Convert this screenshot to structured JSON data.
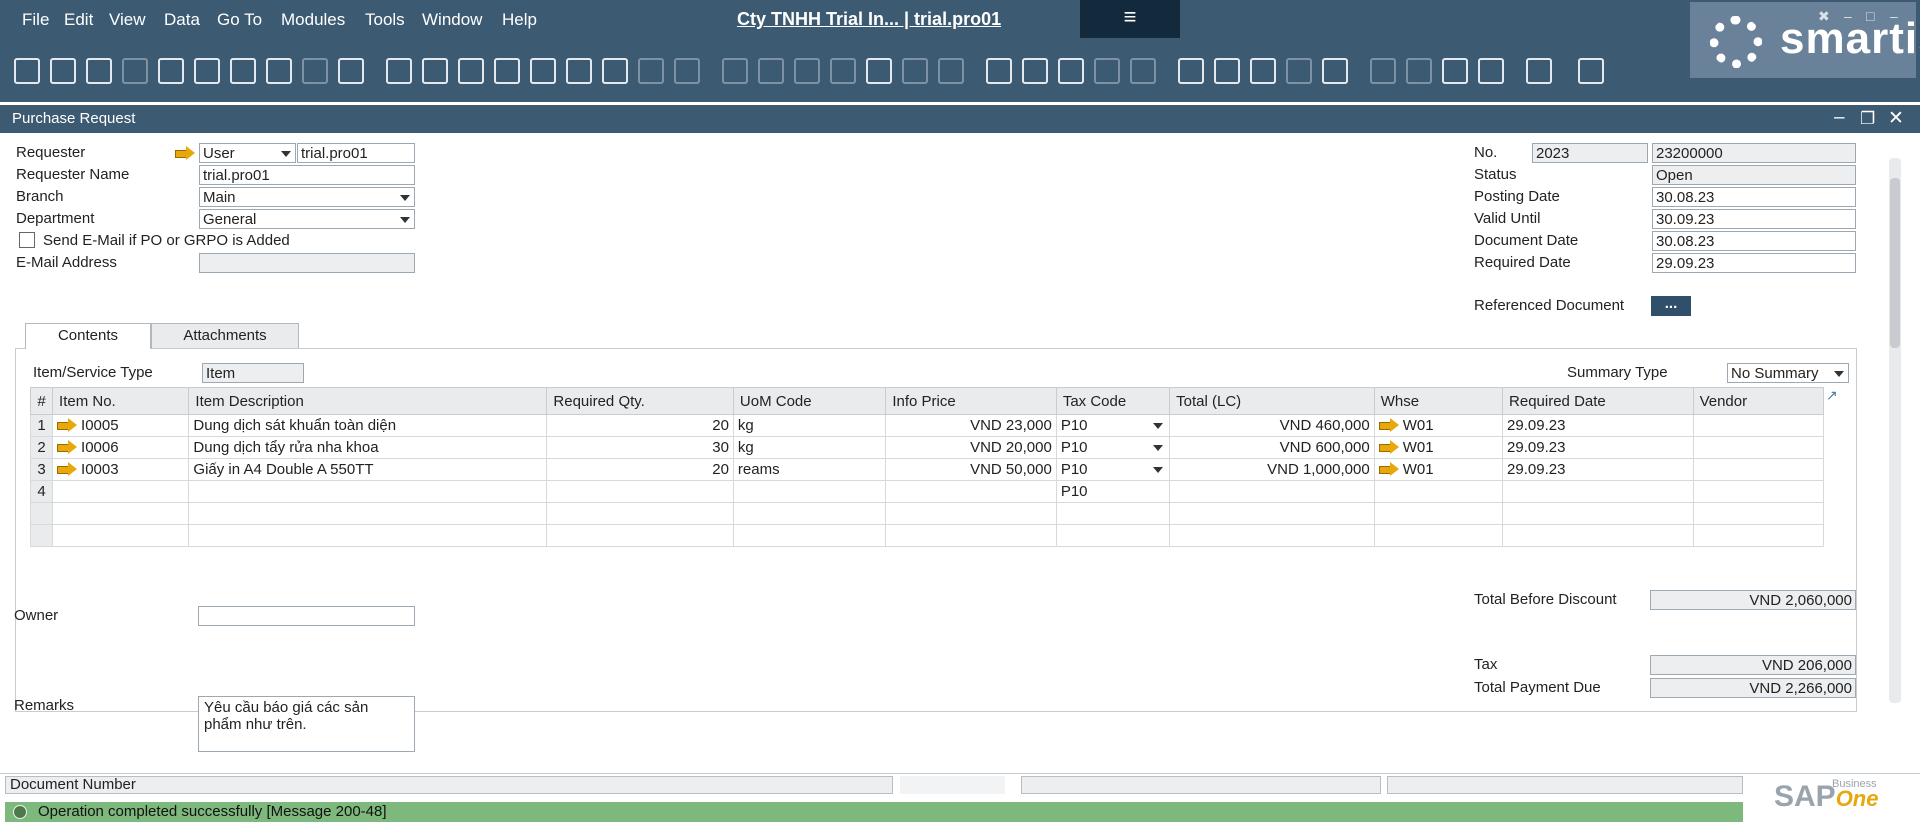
{
  "menu": {
    "items": [
      "File",
      "Edit",
      "View",
      "Data",
      "Go To",
      "Modules",
      "Tools",
      "Window",
      "Help"
    ],
    "title": "Cty TNHH Trial In... | trial.pro01",
    "hamburger": "≡"
  },
  "logo": {
    "text": "smartis"
  },
  "window": {
    "title": "Purchase Request"
  },
  "header_left": {
    "requester_label": "Requester",
    "requester_type": "User",
    "requester_value": "trial.pro01",
    "requester_name_label": "Requester Name",
    "requester_name_value": "trial.pro01",
    "branch_label": "Branch",
    "branch_value": "Main",
    "department_label": "Department",
    "department_value": "General",
    "send_email_label": "Send E-Mail if PO or GRPO is Added",
    "email_label": "E-Mail Address",
    "email_value": ""
  },
  "header_right": {
    "no_label": "No.",
    "no_series": "2023",
    "no_value": "23200000",
    "status_label": "Status",
    "status_value": "Open",
    "posting_label": "Posting Date",
    "posting_value": "30.08.23",
    "valid_label": "Valid Until",
    "valid_value": "30.09.23",
    "docdate_label": "Document Date",
    "docdate_value": "30.08.23",
    "reqdate_label": "Required Date",
    "reqdate_value": "29.09.23",
    "refdoc_label": "Referenced Document",
    "refdoc_button": "..."
  },
  "tabs": [
    "Contents",
    "Attachments"
  ],
  "contents": {
    "type_label": "Item/Service Type",
    "type_value": "Item",
    "summary_label": "Summary Type",
    "summary_value": "No Summary",
    "columns": [
      "#",
      "Item No.",
      "Item Description",
      "Required Qty.",
      "UoM Code",
      "Info Price",
      "Tax Code",
      "Total (LC)",
      "Whse",
      "Required Date",
      "Vendor"
    ],
    "rows": [
      {
        "n": "1",
        "item": "I0005",
        "desc": "Dung dịch sát khuẩn toàn diện",
        "qty": "20",
        "uom": "kg",
        "price": "VND 23,000",
        "tax": "P10",
        "total": "VND 460,000",
        "whse": "W01",
        "date": "29.09.23",
        "vendor": ""
      },
      {
        "n": "2",
        "item": "I0006",
        "desc": "Dung dịch tẩy rửa nha khoa",
        "qty": "30",
        "uom": "kg",
        "price": "VND 20,000",
        "tax": "P10",
        "total": "VND 600,000",
        "whse": "W01",
        "date": "29.09.23",
        "vendor": ""
      },
      {
        "n": "3",
        "item": "I0003",
        "desc": "Giấy in A4 Double A 550TT",
        "qty": "20",
        "uom": "reams",
        "price": "VND 50,000",
        "tax": "P10",
        "total": "VND 1,000,000",
        "whse": "W01",
        "date": "29.09.23",
        "vendor": ""
      },
      {
        "n": "4",
        "item": "",
        "desc": "",
        "qty": "",
        "uom": "",
        "price": "",
        "tax": "P10",
        "total": "",
        "whse": "",
        "date": "",
        "vendor": ""
      }
    ]
  },
  "footer_left": {
    "owner_label": "Owner",
    "owner_value": "",
    "remarks_label": "Remarks",
    "remarks_value": "Yêu cầu báo giá các sản phẩm như trên."
  },
  "totals": {
    "before_discount_label": "Total Before Discount",
    "before_discount_value": "VND 2,060,000",
    "tax_label": "Tax",
    "tax_value": "VND 206,000",
    "payment_label": "Total Payment Due",
    "payment_value": "VND 2,266,000"
  },
  "status": {
    "field_label": "Document Number",
    "message": "Operation completed successfully  [Message 200-48]"
  },
  "sap": {
    "brand": "SAP",
    "sub": "Business",
    "one": "One"
  }
}
